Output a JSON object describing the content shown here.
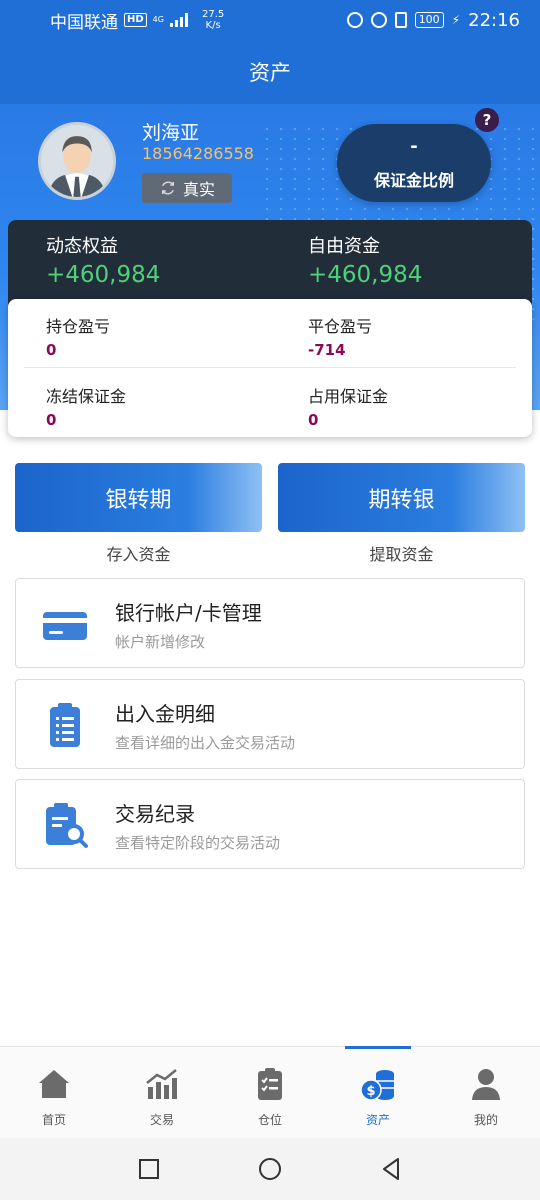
{
  "status_bar": {
    "carrier": "中国联通",
    "hd": "HD",
    "network": "4G",
    "speed_value": "27.5",
    "speed_unit": "K/s",
    "battery": "100",
    "time": "22:16"
  },
  "header": {
    "title": "资产"
  },
  "user": {
    "name": "刘海亚",
    "phone": "18564286558",
    "verified_label": "真实"
  },
  "margin_ratio": {
    "value": "-",
    "label": "保证金比例",
    "help": "?"
  },
  "equity": [
    {
      "label": "动态权益",
      "value": "+460,984"
    },
    {
      "label": "自由资金",
      "value": "+460,984"
    }
  ],
  "stats": [
    {
      "label": "持仓盈亏",
      "value": "0"
    },
    {
      "label": "平仓盈亏",
      "value": "-714"
    },
    {
      "label": "冻结保证金",
      "value": "0"
    },
    {
      "label": "占用保证金",
      "value": "0"
    }
  ],
  "transfer": [
    {
      "label": "银转期",
      "sub": "存入资金"
    },
    {
      "label": "期转银",
      "sub": "提取资金"
    }
  ],
  "menu": [
    {
      "title": "银行帐户/卡管理",
      "sub": "帐户新增修改",
      "icon": "card-icon"
    },
    {
      "title": "出入金明细",
      "sub": "查看详细的出入金交易活动",
      "icon": "clipboard-list-icon"
    },
    {
      "title": "交易纪录",
      "sub": "查看特定阶段的交易活动",
      "icon": "clipboard-search-icon"
    }
  ],
  "nav": [
    {
      "label": "首页",
      "icon": "home-icon"
    },
    {
      "label": "交易",
      "icon": "chart-icon"
    },
    {
      "label": "仓位",
      "icon": "checklist-icon"
    },
    {
      "label": "资产",
      "icon": "coins-icon",
      "active": true
    },
    {
      "label": "我的",
      "icon": "user-icon"
    }
  ],
  "colors": {
    "primary": "#1f6fd6",
    "positive": "#4fd07a",
    "stat_value": "#8a0a5a",
    "phone": "#f7c16a"
  }
}
